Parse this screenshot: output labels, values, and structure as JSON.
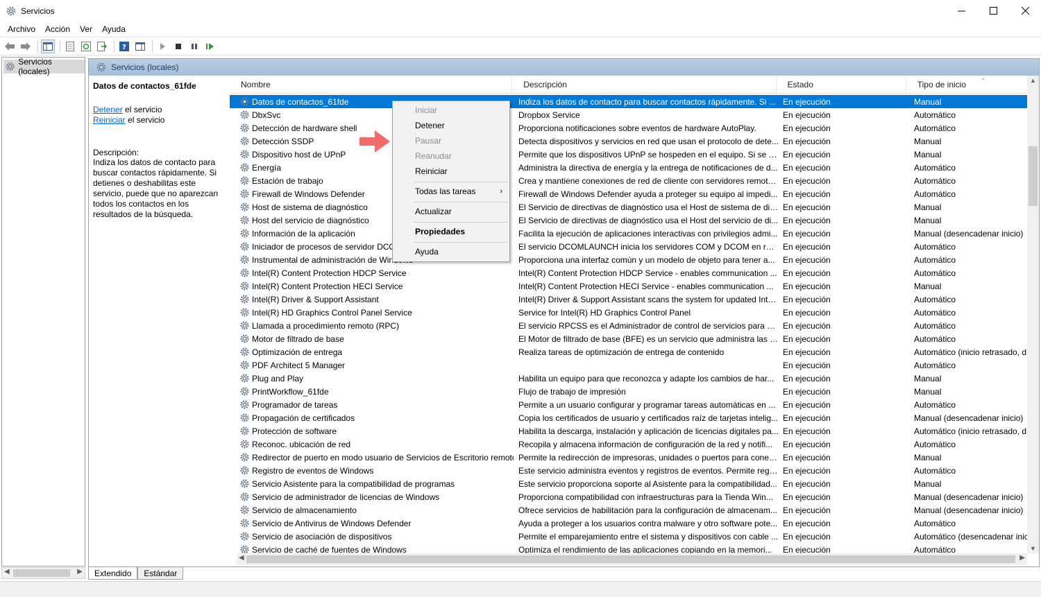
{
  "window": {
    "title": "Servicios"
  },
  "menubar": {
    "items": [
      "Archivo",
      "Acción",
      "Ver",
      "Ayuda"
    ]
  },
  "tree": {
    "root_label": "Servicios (locales)"
  },
  "pane": {
    "header": "Servicios (locales)"
  },
  "detail": {
    "service_name": "Datos de contactos_61fde",
    "stop_link": "Detener",
    "stop_suffix": " el servicio",
    "restart_link": "Reiniciar",
    "restart_suffix": " el servicio",
    "desc_label": "Descripción:",
    "desc_text": "Indiza los datos de contacto para buscar contactos rápidamente. Si detienes o deshabilitas este servicio, puede que no aparezcan todos los contactos en los resultados de la búsqueda."
  },
  "columns": [
    "Nombre",
    "Descripción",
    "Estado",
    "Tipo de inicio"
  ],
  "services": [
    {
      "name": "Datos de contactos_61fde",
      "desc": "Indiza los datos de contacto para buscar contactos rápidamente. Si ...",
      "state": "En ejecución",
      "start": "Manual"
    },
    {
      "name": "DbxSvc",
      "desc": "Dropbox Service",
      "state": "En ejecución",
      "start": "Automático"
    },
    {
      "name": "Detección de hardware shell",
      "desc": "Proporciona notificaciones sobre eventos de hardware AutoPlay.",
      "state": "En ejecución",
      "start": "Automático"
    },
    {
      "name": "Detección SSDP",
      "desc": "Detecta dispositivos y servicios en red que usan el protocolo de dete...",
      "state": "En ejecución",
      "start": "Manual"
    },
    {
      "name": "Dispositivo host de UPnP",
      "desc": "Permite que los dispositivos UPnP se hospeden en el equipo. Si se d...",
      "state": "En ejecución",
      "start": "Manual"
    },
    {
      "name": "Energía",
      "desc": "Administra la directiva de energía y la entrega de notificaciones de d...",
      "state": "En ejecución",
      "start": "Automático"
    },
    {
      "name": "Estación de trabajo",
      "desc": "Crea y mantiene conexiones de red de cliente con servidores remoto...",
      "state": "En ejecución",
      "start": "Automático"
    },
    {
      "name": "Firewall de Windows Defender",
      "desc": "Firewall de Windows Defender ayuda a proteger su equipo al impedi...",
      "state": "En ejecución",
      "start": "Automático"
    },
    {
      "name": "Host de sistema de diagnóstico",
      "desc": "El Servicio de directivas de diagnóstico usa el Host de sistema de dia...",
      "state": "En ejecución",
      "start": "Manual"
    },
    {
      "name": "Host del servicio de diagnóstico",
      "desc": "El Servicio de directivas de diagnóstico usa el Host del servicio de di...",
      "state": "En ejecución",
      "start": "Manual"
    },
    {
      "name": "Información de la aplicación",
      "desc": "Facilita la ejecución de aplicaciones interactivas con privilegios admi...",
      "state": "En ejecución",
      "start": "Manual (desencadenar inicio)"
    },
    {
      "name": "Iniciador de procesos de servidor DCOM",
      "desc": "El servicio DCOMLAUNCH inicia los servidores COM y DCOM en res...",
      "state": "En ejecución",
      "start": "Automático"
    },
    {
      "name": "Instrumental de administración de Windows",
      "desc": "Proporciona una interfaz común y un modelo de objeto para tener a...",
      "state": "En ejecución",
      "start": "Automático"
    },
    {
      "name": "Intel(R) Content Protection HDCP Service",
      "desc": "Intel(R) Content Protection HDCP Service - enables communication ...",
      "state": "En ejecución",
      "start": "Automático"
    },
    {
      "name": "Intel(R) Content Protection HECI Service",
      "desc": "Intel(R) Content Protection HECI Service - enables communication ...",
      "state": "En ejecución",
      "start": "Manual"
    },
    {
      "name": "Intel(R) Driver & Support Assistant",
      "desc": "Intel(R) Driver & Support Assistant scans the system for updated Inte...",
      "state": "En ejecución",
      "start": "Automático"
    },
    {
      "name": "Intel(R) HD Graphics Control Panel Service",
      "desc": "Service for Intel(R) HD Graphics Control Panel",
      "state": "En ejecución",
      "start": "Automático"
    },
    {
      "name": "Llamada a procedimiento remoto (RPC)",
      "desc": "El servicio RPCSS es el Administrador de control de servicios para ser...",
      "state": "En ejecución",
      "start": "Automático"
    },
    {
      "name": "Motor de filtrado de base",
      "desc": "El Motor de filtrado de base (BFE) es un servicio que administra las d...",
      "state": "En ejecución",
      "start": "Automático"
    },
    {
      "name": "Optimización de entrega",
      "desc": "Realiza tareas de optimización de entrega de contenido",
      "state": "En ejecución",
      "start": "Automático (inicio retrasado, d"
    },
    {
      "name": "PDF Architect 5 Manager",
      "desc": "",
      "state": "En ejecución",
      "start": "Automático"
    },
    {
      "name": "Plug and Play",
      "desc": "Habilita un equipo para que reconozca y adapte los cambios de har...",
      "state": "En ejecución",
      "start": "Manual"
    },
    {
      "name": "PrintWorkflow_61fde",
      "desc": "Flujo de trabajo de impresión",
      "state": "En ejecución",
      "start": "Manual"
    },
    {
      "name": "Programador de tareas",
      "desc": "Permite a un usuario configurar y programar tareas automáticas en ...",
      "state": "En ejecución",
      "start": "Automático"
    },
    {
      "name": "Propagación de certificados",
      "desc": "Copia los certificados de usuario y certificados raíz de tarjetas intelig...",
      "state": "En ejecución",
      "start": "Manual (desencadenar inicio)"
    },
    {
      "name": "Protección de software",
      "desc": "Habilita la descarga, instalación y aplicación de licencias digitales pa...",
      "state": "En ejecución",
      "start": "Automático (inicio retrasado, d"
    },
    {
      "name": "Reconoc. ubicación de red",
      "desc": "Recopila y almacena información de configuración de la red y notifi...",
      "state": "En ejecución",
      "start": "Automático"
    },
    {
      "name": "Redirector de puerto en modo usuario de Servicios de Escritorio remoto",
      "desc": "Permite la redirección de impresoras, unidades o puertos para conex...",
      "state": "En ejecución",
      "start": "Manual"
    },
    {
      "name": "Registro de eventos de Windows",
      "desc": "Este servicio administra eventos y registros de eventos. Permite regis...",
      "state": "En ejecución",
      "start": "Automático"
    },
    {
      "name": "Servicio Asistente para la compatibilidad de programas",
      "desc": "Este servicio proporciona soporte al Asistente para la compatibilidad...",
      "state": "En ejecución",
      "start": "Manual"
    },
    {
      "name": "Servicio de administrador de licencias de Windows",
      "desc": "Proporciona compatibilidad con infraestructuras para la Tienda Win...",
      "state": "En ejecución",
      "start": "Manual (desencadenar inicio)"
    },
    {
      "name": "Servicio de almacenamiento",
      "desc": "Ofrece servicios de habilitación para la configuración de almacenam...",
      "state": "En ejecución",
      "start": "Manual (desencadenar inicio)"
    },
    {
      "name": "Servicio de Antivirus de Windows Defender",
      "desc": "Ayuda a proteger a los usuarios contra malware y otro software pote...",
      "state": "En ejecución",
      "start": "Automático"
    },
    {
      "name": "Servicio de asociación de dispositivos",
      "desc": "Permite el emparejamiento entre el sistema y dispositivos con cable ...",
      "state": "En ejecución",
      "start": "Automático (desencadenar inic"
    },
    {
      "name": "Servicio de caché de fuentes de Windows",
      "desc": "Optimiza el rendimiento de las aplicaciones copiando en la memori...",
      "state": "En ejecución",
      "start": "Automático"
    }
  ],
  "context_menu": {
    "items": [
      "Iniciar",
      "Detener",
      "Pausar",
      "Reanudar",
      "Reiniciar",
      "Todas las tareas",
      "Actualizar",
      "Propiedades",
      "Ayuda"
    ]
  },
  "tabs": [
    "Extendido",
    "Estándar"
  ],
  "colors": {
    "selection": "#0078d7",
    "header": "#b9cfe4",
    "link": "#0066cc",
    "annotation_arrow": "#f26b6b"
  }
}
